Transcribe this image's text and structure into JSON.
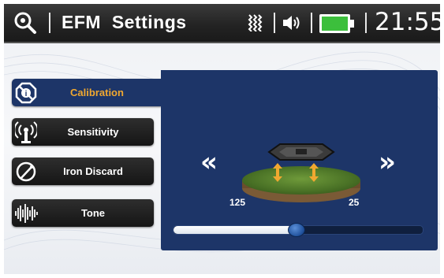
{
  "statusbar": {
    "title": "EFM  Settings",
    "time": "21:55",
    "icons": [
      "search-icon",
      "signal-icon",
      "volume-icon",
      "battery-icon"
    ],
    "battery_color": "#3cbf3c"
  },
  "menu": {
    "items": [
      {
        "label": "Calibration",
        "icon": "calibration-icon",
        "active": true
      },
      {
        "label": "Sensitivity",
        "icon": "sensitivity-icon",
        "active": false
      },
      {
        "label": "Iron Discard",
        "icon": "iron-discard-icon",
        "active": false
      },
      {
        "label": "Tone",
        "icon": "tone-icon",
        "active": false
      }
    ]
  },
  "calibration": {
    "left_value": "125",
    "right_value": "25",
    "prev_label": "«",
    "next_label": "»",
    "slider_fraction": 0.49
  },
  "colors": {
    "panel": "#1d3568",
    "accent": "#f0a830"
  }
}
